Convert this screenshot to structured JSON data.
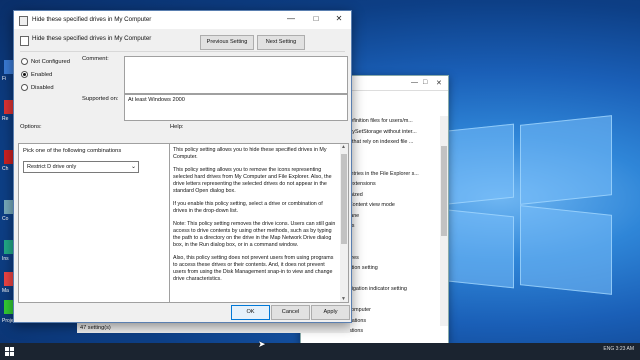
{
  "dialog": {
    "window_title": "Hide these specified drives in My Computer",
    "header_title": "Hide these specified drives in My Computer",
    "prev_button": "Previous Setting",
    "next_button": "Next Setting",
    "radios": [
      {
        "label": "Not Configured",
        "selected": false
      },
      {
        "label": "Enabled",
        "selected": true
      },
      {
        "label": "Disabled",
        "selected": false
      }
    ],
    "comment_label": "Comment:",
    "supported_label": "Supported on:",
    "supported_value": "At least Windows 2000",
    "options_label": "Options:",
    "help_label": "Help:",
    "options_prompt": "Pick one of the following combinations",
    "dropdown_value": "Restrict D drive only",
    "help_paragraphs": [
      "This policy setting allows you to hide these specified drives in My Computer.",
      "This policy setting allows you to remove the icons representing selected hard drives from My Computer and File Explorer. Also, the drive letters representing the selected drives do not appear in the standard Open dialog box.",
      "If you enable this policy setting, select a drive or combination of drives in the drop-down list.",
      "Note: This policy setting removes the drive icons. Users can still gain access to drive contents by using other methods, such as by typing the path to a directory on the drive in the Map Network Drive dialog box, in the Run dialog box, or in a command window.",
      "Also, this policy setting does not prevent users from using programs to access these drives or their contents. And, it does not prevent users from using the Disk Management snap-in to view and change drive characteristics."
    ],
    "ok_button": "OK",
    "cancel_button": "Cancel",
    "apply_button": "Apply"
  },
  "background_window": {
    "items": [
      "y definition files for users/m...",
      "pertySetStorage without inter...",
      "res that rely on indexed file ...",
      "",
      "",
      "h entries in the File Explorer s...",
      "ell extensions",
      "inimized",
      "in Content view mode",
      "s pane",
      "tings",
      "",
      "",
      "ictures",
      "imation setting",
      "t",
      "navigation indicator setting",
      "",
      "y Computer",
      "Locations",
      "ocations"
    ]
  },
  "status_bar": {
    "text": "47 setting(s)"
  },
  "desktop": {
    "labels": [
      "Fi",
      "Re",
      "Ch",
      "Co",
      "Ins",
      "Ma",
      "Projects"
    ]
  },
  "taskbar": {
    "tray_text": "ENG  3:23 AM"
  },
  "colors": {
    "accent": "#0078d7",
    "desktop": "#1a5fb7"
  }
}
